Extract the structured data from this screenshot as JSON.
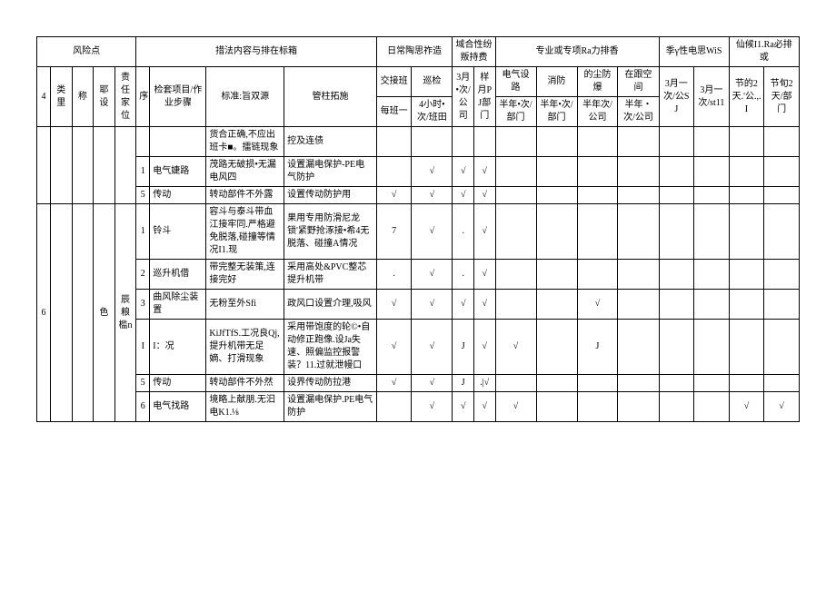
{
  "header": {
    "grp1": "风险点",
    "grp2": "措法内容与排在标箱",
    "grp3": "日常陶思祚造",
    "grp4": "域合性纷叛持费",
    "grp5": "专业或专项Ra力排香",
    "grp6": "季γ性电思WiS",
    "grp7": "仙候I1.Ra必排或",
    "c0": "4",
    "c1": "类里",
    "c2": "称",
    "c3": "耶设",
    "c4": "责任家位",
    "c5": "序",
    "c6": "检套项目/作业步骤",
    "c7": "标准:旨双源",
    "c8": "管柱拓施",
    "c9a": "交接班",
    "c9b": "每班一",
    "c10a": "巡检",
    "c10b": "4小时•次/班田",
    "c11a": "3月•次/公司",
    "c12a": "样月PJ部门",
    "c13a": "电气设路",
    "c13b": "半年•次/部门",
    "c14a": "消防",
    "c14b": "半年•次/部门",
    "c15a": "的尘防爆",
    "c15b": "半年次/公司",
    "c16a": "在跟空间",
    "c16b": "半年・次/公司",
    "c17": "3月一次/公SJ",
    "c18": "3月一次/st11",
    "c19": "节的2天.'公.,.I",
    "c20": "节旬2天/部门"
  },
  "rows": [
    {
      "c7": "货合正确,不应出班卡■。擂链现象",
      "c8": "控及连债"
    },
    {
      "c5": "1",
      "c6": "电气婕路",
      "c7": "茂路无破损•无漏电风四",
      "c8": "设置漏电保护-PE电气防护",
      "c10": "√",
      "c11": "√",
      "c12": "√"
    },
    {
      "c5": "5",
      "c6": "传动",
      "c7": "转动部件不外露",
      "c8": "设置传动防护用",
      "c9": "√",
      "c10": "√",
      "c11": "√",
      "c12": "√"
    },
    {
      "c0": "6",
      "c3": "色",
      "c4": "辰粮槛n",
      "c5": "1",
      "c6": "铃斗",
      "c7": "容斗与泰斗带血江接牢同.严格避免脱落,碰撞等情况I1.现",
      "c8": "果用专用防滑尼龙锁'紧野抢涿接•希4无脱落、碰撞A情况",
      "c9": "7",
      "c10": "√",
      "c11": ".",
      "c12": "√"
    },
    {
      "c5": "2",
      "c6": "巡升机借",
      "c7": "带完整无装策,连接完好",
      "c8": "采用高处&PVC整芯提升机带",
      "c9": ".",
      "c10": "√",
      "c11": ".",
      "c12": "√"
    },
    {
      "c5": "3",
      "c6": "曲风除尘装置",
      "c7": "无粉至外Sfi",
      "c8": "政风口设置介理,吸风",
      "c9": "√",
      "c10": "√",
      "c11": "√",
      "c12": "√",
      "c15": "√"
    },
    {
      "c5": "I",
      "c6": "I：况",
      "c7": "KiJfTfS.工况良Qj,提升机带无足嫡、打滑现象",
      "c8": "采用带饱度的轮©•自动修正跑像.设Ja失速、照偏监控报警装？11.过就泄幔口",
      "c9": "√",
      "c10": "√",
      "c11": "J",
      "c12": "√",
      "c13": "√",
      "c15": "J"
    },
    {
      "c5": "5",
      "c6": "传动",
      "c7": "转动部件不外然",
      "c8": "设界传动防拉港",
      "c9": "√",
      "c10": "√",
      "c11": "J",
      "c12": ".|√"
    },
    {
      "c5": "6",
      "c6": "电气找路",
      "c7": "境略上献朋.无汩电K1.⅛",
      "c8": "设置漏电保护.PE电气防护",
      "c10": "√",
      "c11": "√",
      "c12": "√",
      "c13": "√",
      "c19": "√",
      "c20": "√"
    }
  ]
}
